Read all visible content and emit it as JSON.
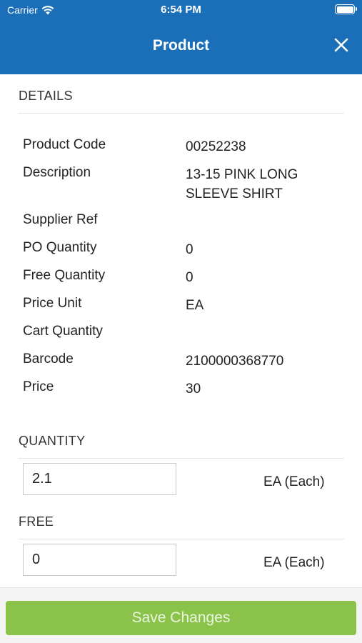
{
  "status_bar": {
    "carrier": "Carrier",
    "time": "6:54 PM"
  },
  "nav": {
    "title": "Product",
    "close_icon": "close-icon"
  },
  "details": {
    "header": "DETAILS",
    "rows": [
      {
        "label": "Product Code",
        "value": "00252238"
      },
      {
        "label": "Description",
        "value": "13-15 PINK LONG SLEEVE SHIRT"
      },
      {
        "label": "Supplier Ref",
        "value": ""
      },
      {
        "label": "PO Quantity",
        "value": "0"
      },
      {
        "label": "Free Quantity",
        "value": "0"
      },
      {
        "label": "Price Unit",
        "value": "EA"
      },
      {
        "label": "Cart Quantity",
        "value": ""
      },
      {
        "label": "Barcode",
        "value": "2100000368770"
      },
      {
        "label": "Price",
        "value": "30"
      }
    ]
  },
  "quantity": {
    "header": "QUANTITY",
    "value": "2.1",
    "unit": "EA (Each)"
  },
  "free": {
    "header": "FREE",
    "value": "0",
    "unit": "EA (Each)"
  },
  "footer": {
    "save_label": "Save Changes"
  },
  "colors": {
    "brand_blue": "#1a6fb8",
    "save_green": "#8bc34a"
  }
}
